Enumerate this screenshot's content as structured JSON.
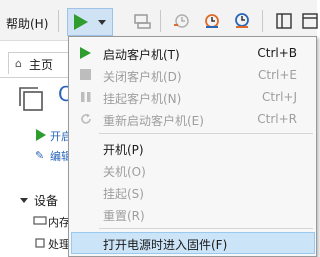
{
  "toolbar": {
    "help_menu": "帮助(H)",
    "icons": [
      "play-icon",
      "dropdown-arrow-icon",
      "send-keys-icon",
      "snapshot-icon",
      "revert-snapshot-icon",
      "manage-snapshots-icon",
      "sidebar-toggle-icon",
      "console-view-icon"
    ]
  },
  "background": {
    "home_tab": "主页",
    "action_power_on": "开启",
    "action_edit": "编辑",
    "devices_header": "设备",
    "device_memory": "内存",
    "device_processor": "处理"
  },
  "menu": {
    "items": [
      {
        "label": "启动客户机(T)",
        "shortcut": "Ctrl+B",
        "enabled": true,
        "icon": "play-icon"
      },
      {
        "label": "关闭客户机(D)",
        "shortcut": "Ctrl+E",
        "enabled": false,
        "icon": "stop-icon"
      },
      {
        "label": "挂起客户机(N)",
        "shortcut": "Ctrl+J",
        "enabled": false,
        "icon": "pause-icon"
      },
      {
        "label": "重新启动客户机(E)",
        "shortcut": "Ctrl+R",
        "enabled": false,
        "icon": "restart-icon"
      },
      {
        "label": "开机(P)",
        "shortcut": "",
        "enabled": true
      },
      {
        "label": "关机(O)",
        "shortcut": "",
        "enabled": false
      },
      {
        "label": "挂起(S)",
        "shortcut": "",
        "enabled": false
      },
      {
        "label": "重置(R)",
        "shortcut": "",
        "enabled": false
      },
      {
        "label": "打开电源时进入固件(F)",
        "shortcut": "",
        "enabled": true,
        "highlighted": true
      }
    ]
  },
  "colors": {
    "accent": "#2e9d2e",
    "highlight": "#cce4f7",
    "link": "#2a66b8",
    "disabled": "#9e9e9e"
  }
}
